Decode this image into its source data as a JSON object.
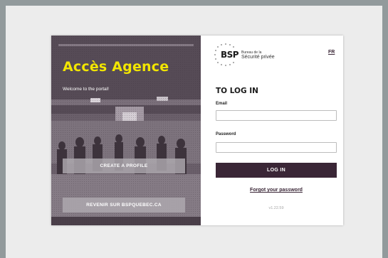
{
  "hero": {
    "title": "Accès Agence",
    "subtitle": "Welcome to the portal!",
    "create_profile_label": "CREATE A PROFILE",
    "back_label": "REVENIR SUR BSPQUEBEC.CA"
  },
  "logo": {
    "abbr": "BSP",
    "name_line1": "Bureau de la",
    "name_line2": "Sécurité privée"
  },
  "lang_switch": "FR",
  "login": {
    "title": "TO LOG IN",
    "email_label": "Email",
    "email_value": "",
    "password_label": "Password",
    "password_value": "",
    "submit_label": "LOG IN",
    "forgot_label": "Forgot your password"
  },
  "version": "v1.22.59",
  "colors": {
    "accent": "#3a2636",
    "title_yellow": "#f2e600",
    "page_frame": "#929a9c"
  }
}
